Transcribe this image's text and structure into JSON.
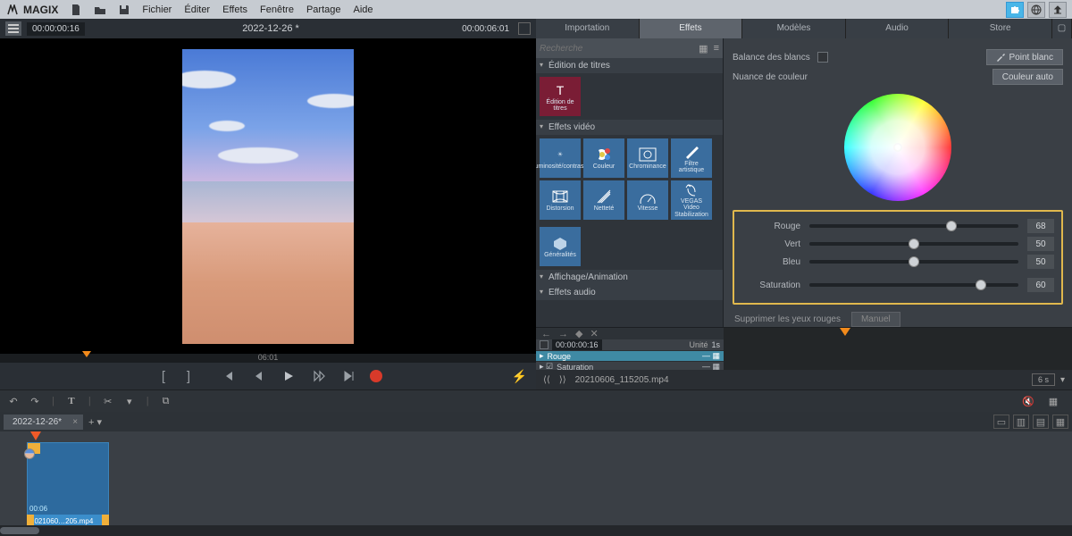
{
  "brand": "MAGIX",
  "menu": {
    "file": "Fichier",
    "edit": "Éditer",
    "effects": "Effets",
    "window": "Fenêtre",
    "share": "Partage",
    "help": "Aide"
  },
  "preview": {
    "timecode_in": "00:00:00:16",
    "project_title": "2022-12-26 *",
    "timecode_out": "00:00:06:01",
    "center_tc": "06:01"
  },
  "right_tabs": {
    "import": "Importation",
    "effects": "Effets",
    "templates": "Modèles",
    "audio": "Audio",
    "store": "Store"
  },
  "effects": {
    "search_placeholder": "Recherche",
    "cat_titles": "Édition de titres",
    "tile_titles": "Édition de titres",
    "cat_video": "Effets vidéo",
    "brightness": "Luminosité/contraste",
    "color": "Couleur",
    "chrominance": "Chrominance",
    "artfilter": "Filtre artistique",
    "distortion": "Distorsion",
    "sharpness": "Netteté",
    "speed": "Vitesse",
    "vegas": "VEGAS Video Stabilization",
    "general": "Généralités",
    "cat_anim": "Affichage/Animation",
    "cat_audio": "Effets audio"
  },
  "colorpanel": {
    "balance_label": "Balance des blancs",
    "whitepoint": "Point blanc",
    "nuance_label": "Nuance de couleur",
    "autocolor": "Couleur auto",
    "sliders": {
      "rouge_label": "Rouge",
      "rouge": 68,
      "vert_label": "Vert",
      "vert": 50,
      "bleu_label": "Bleu",
      "bleu": 50,
      "sat_label": "Saturation",
      "sat": 60
    },
    "redeye": "Supprimer les yeux rouges",
    "manual": "Manuel"
  },
  "keyframes": {
    "tc": "00:00:00:16",
    "unit_label": "Unité",
    "unit_val": "1s",
    "row1": "Rouge",
    "row2": "Saturation"
  },
  "source": {
    "filename": "20210606_115205.mp4",
    "duration": "6 s"
  },
  "timeline": {
    "tab": "2022-12-26*",
    "clip_name": "2021060…205.mp4",
    "clip_dur": "00:06"
  }
}
